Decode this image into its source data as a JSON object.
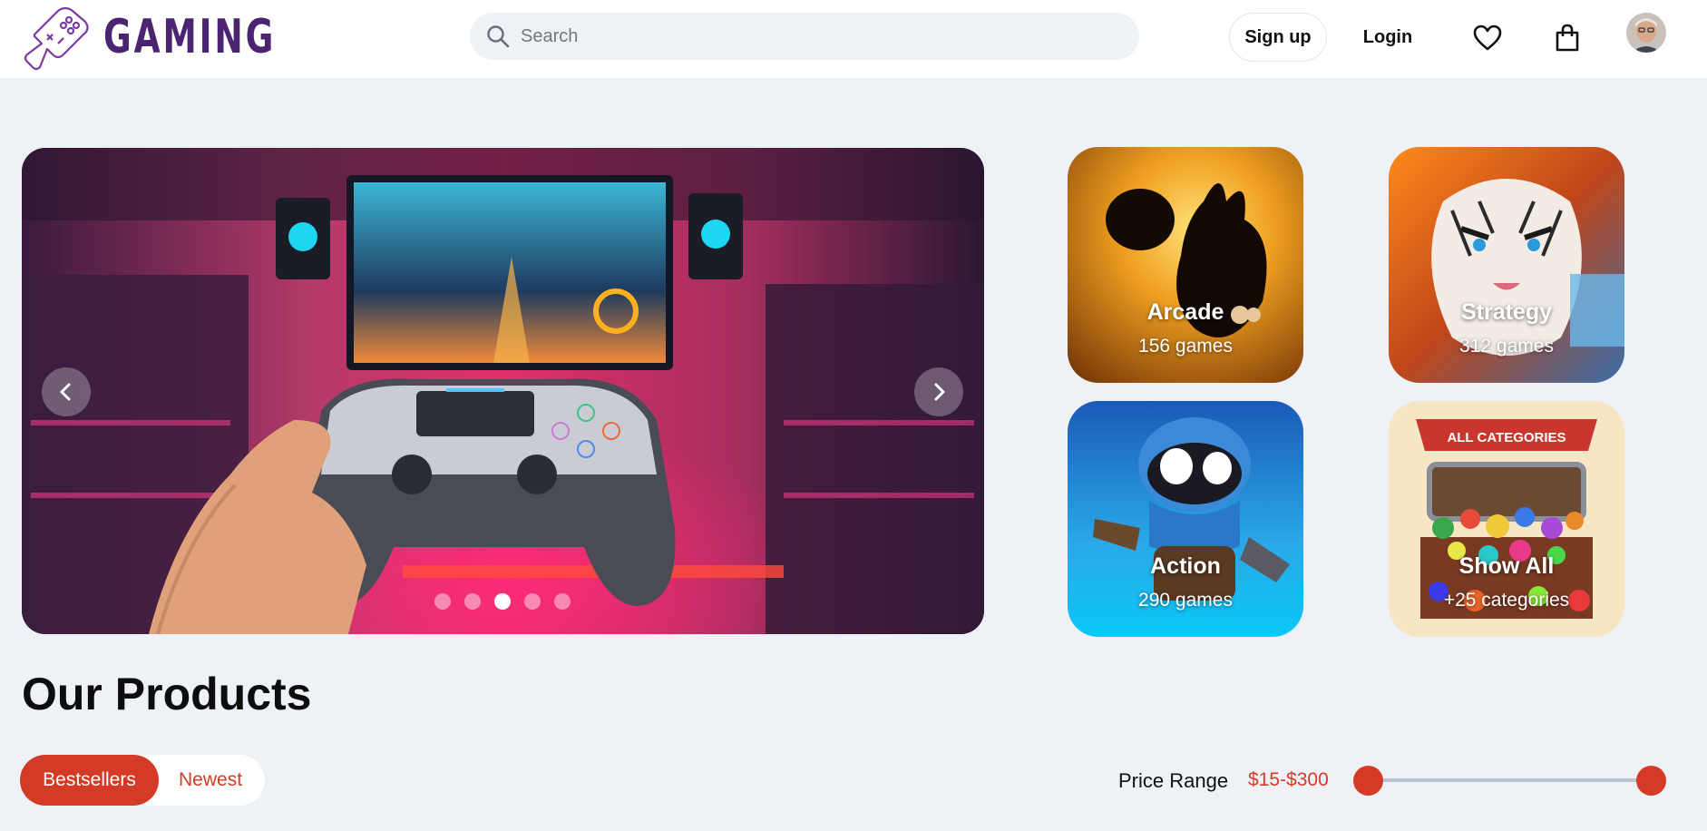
{
  "header": {
    "logo_text": "GAMING",
    "search_placeholder": "Search",
    "signup_label": "Sign up",
    "login_label": "Login"
  },
  "hero": {
    "slide_count": 5,
    "active_slide": 3
  },
  "categories": [
    {
      "title": "Arcade",
      "count": "156 games"
    },
    {
      "title": "Strategy",
      "count": "312 games"
    },
    {
      "title": "Action",
      "count": "290 games"
    },
    {
      "title": "Show All",
      "count": "+25 categories",
      "banner": "ALL CATEGORIES"
    }
  ],
  "products": {
    "title": "Our Products",
    "tabs": [
      "Bestsellers",
      "Newest"
    ],
    "active_tab": "Bestsellers",
    "price_label": "Price Range",
    "price_value": "$15-$300",
    "price_min": 15,
    "price_max": 300
  },
  "colors": {
    "accent": "#d43b27",
    "brand": "#4a2470",
    "background": "#eef1f6"
  }
}
